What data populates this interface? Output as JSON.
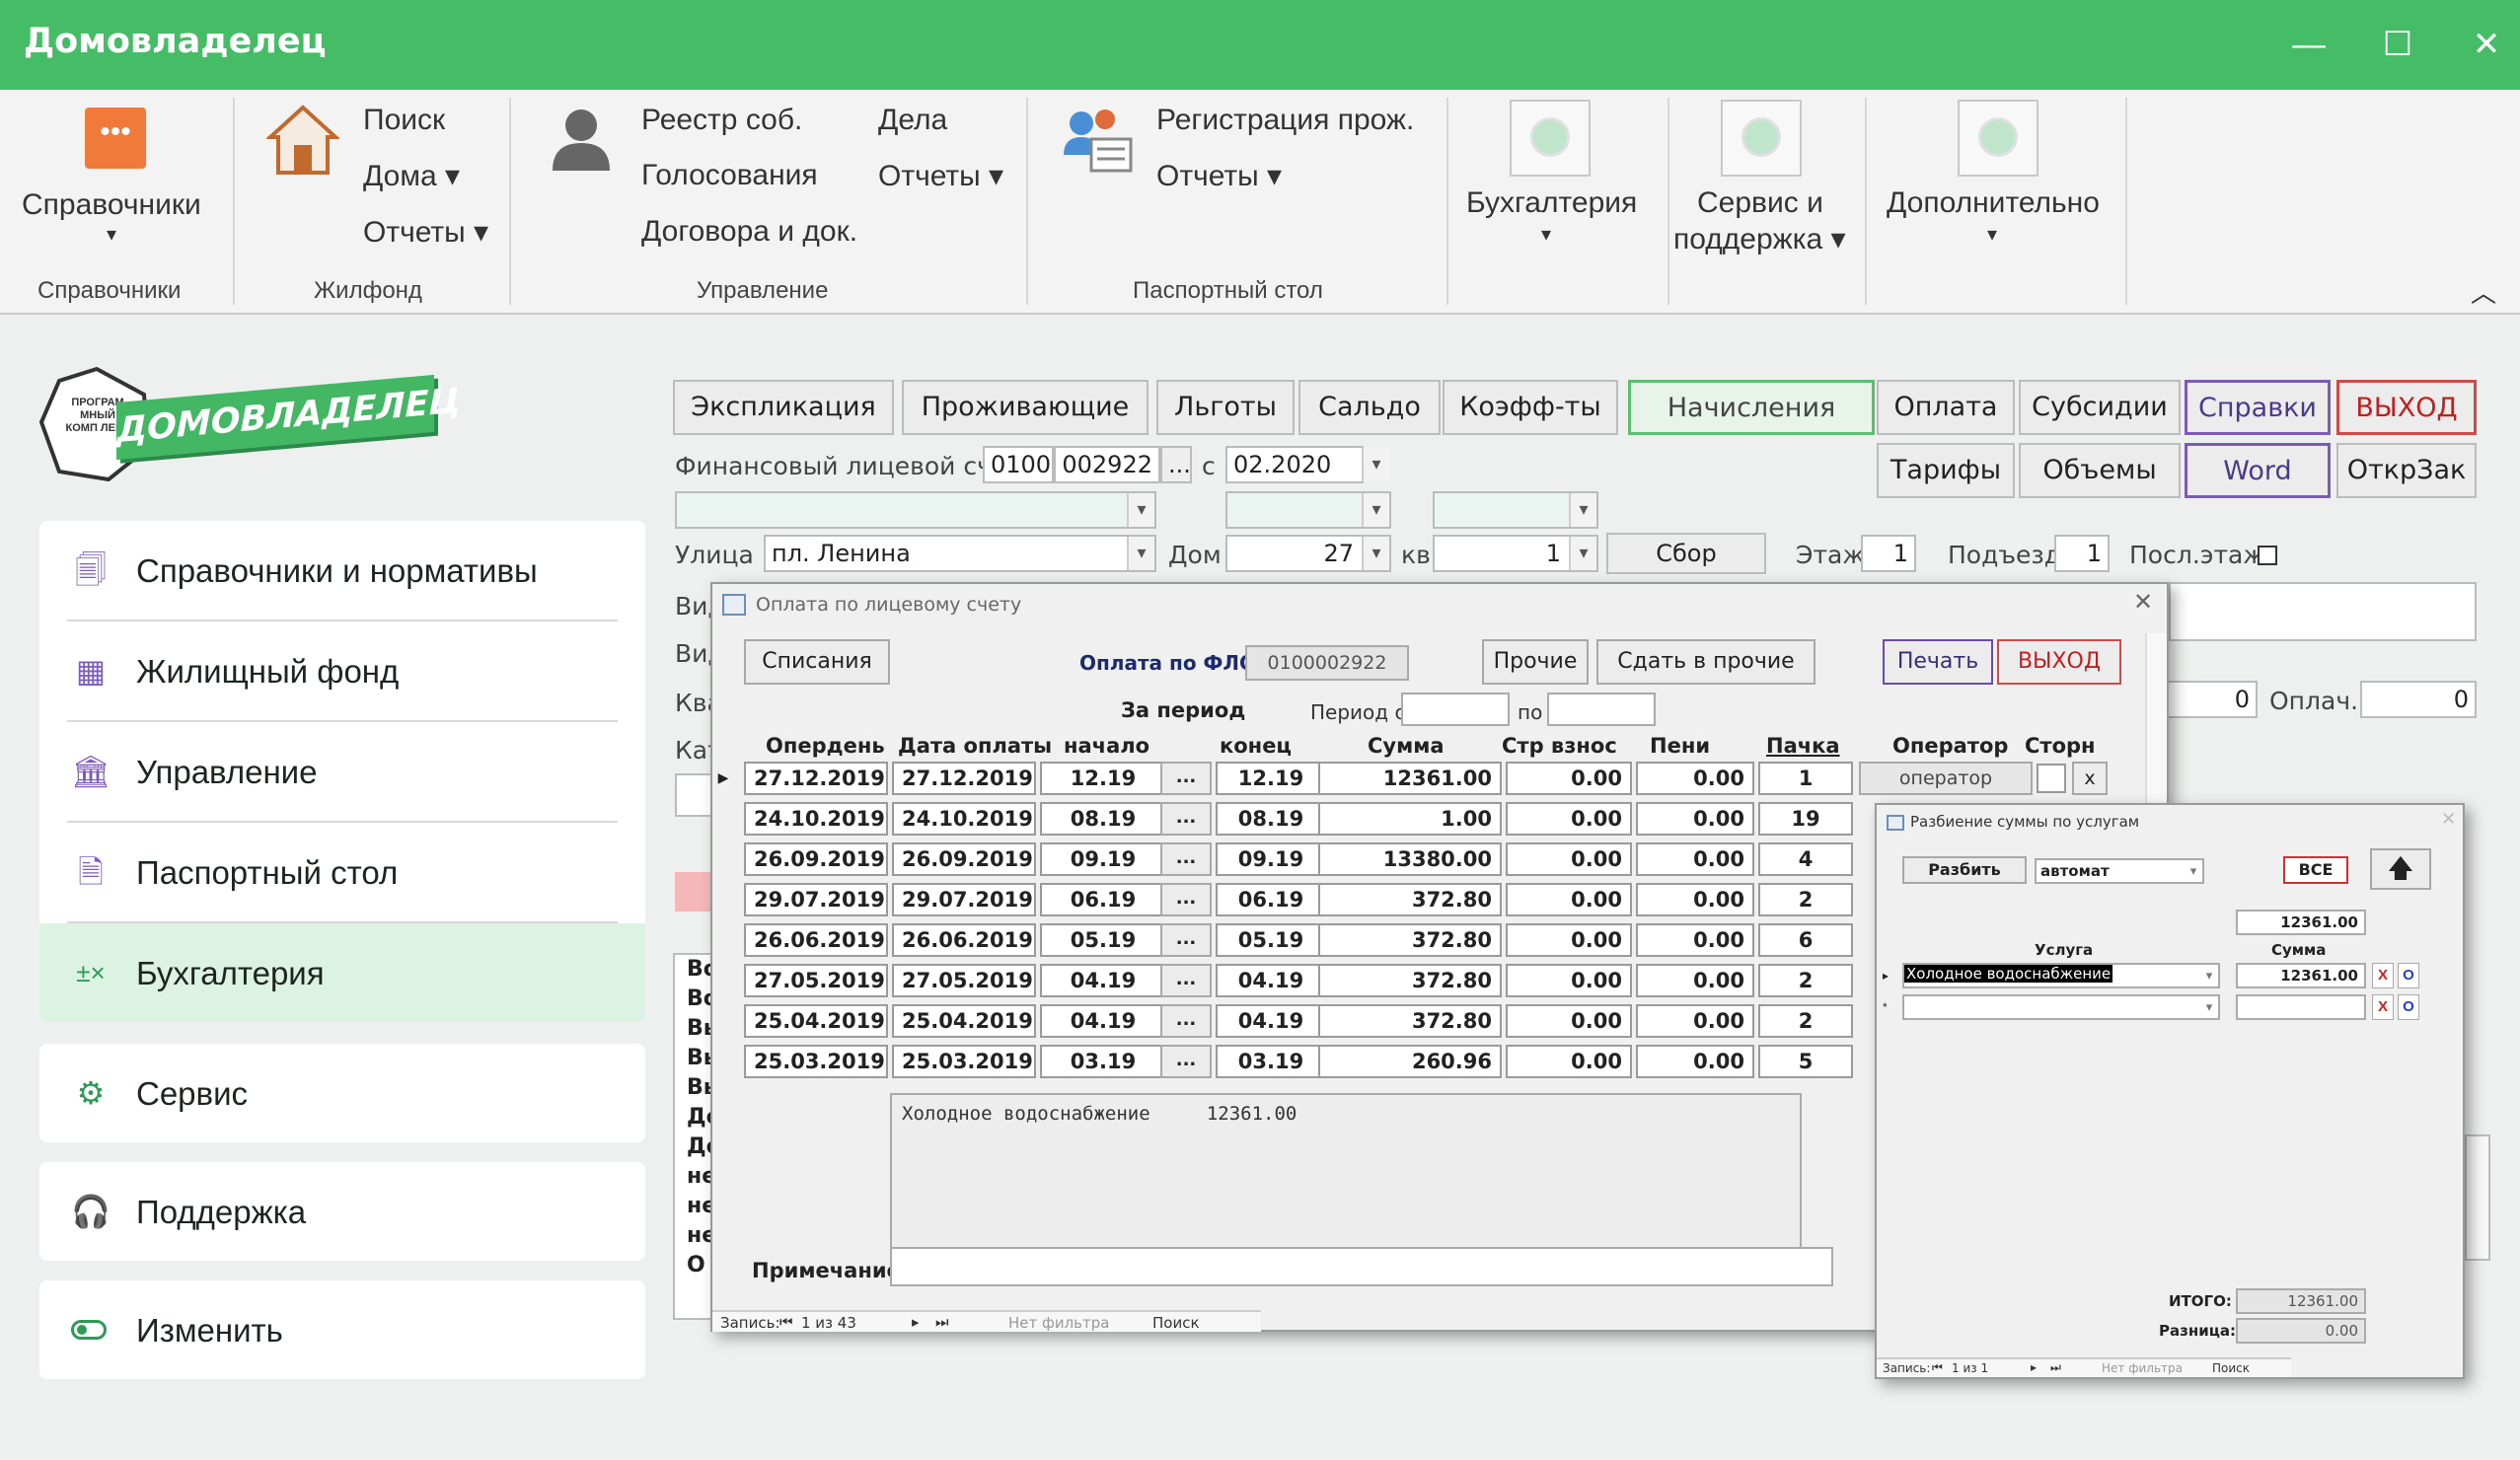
{
  "app": {
    "title": "Домовладелец",
    "min": "—",
    "max": "☐",
    "close": "✕"
  },
  "ribbon": {
    "sprav": {
      "label": "Справочники",
      "group": "Справочники"
    },
    "zhil": {
      "items": [
        "Поиск",
        "Дома ▾",
        "Отчеты ▾"
      ],
      "group": "Жилфонд"
    },
    "upr": {
      "items": [
        "Реестр соб.",
        "Голосования",
        "Договора и док."
      ],
      "items2": [
        "Дела",
        "Отчеты ▾"
      ],
      "group": "Управление"
    },
    "pasp": {
      "items": [
        "Регистрация прож.",
        "Отчеты ▾"
      ],
      "group": "Паспортный стол"
    },
    "buh": {
      "label": "Бухгалтерия"
    },
    "serv": {
      "label1": "Сервис и",
      "label2": "поддержка ▾"
    },
    "dop": {
      "label": "Дополнительно"
    },
    "caret": "▾",
    "collapse": "︿"
  },
  "logo": {
    "text": "ДОМОВЛАДЕЛЕЦ",
    "badge": "ПРОГРАМ МНЫЙ КОМП ЛЕКС"
  },
  "sidebar": {
    "items": [
      "Справочники и нормативы",
      "Жилищный фонд",
      "Управление",
      "Паспортный стол",
      "Бухгалтерия",
      "Сервис",
      "Поддержка",
      "Изменить"
    ],
    "icons": [
      "document-icon",
      "building-icon",
      "bank-icon",
      "passport-icon",
      "calculator-icon",
      "gear-icon",
      "headset-icon",
      "toggle-icon"
    ]
  },
  "main": {
    "tabs": [
      "Экспликация",
      "Проживающие",
      "Льготы",
      "Сальдо",
      "Коэфф-ты",
      "Начисления",
      "Оплата",
      "Субсидии",
      "Справки",
      "ВЫХОД"
    ],
    "tabs2": [
      "Тарифы",
      "Объемы",
      "Word",
      "ОткрЗак"
    ],
    "fls_label": "Финансовый лицевой счет",
    "fls1": "0100",
    "fls2": "002922",
    "dots": "...",
    "s_label": "с",
    "period": "02.2020",
    "ulica_label": "Улица",
    "ulica": "пл. Ленина",
    "dom_label": "Дом",
    "dom": "27",
    "kv_label": "кв",
    "kv": "1",
    "sbor": "Сбор",
    "etazh_label": "Этаж",
    "etazh": "1",
    "podezd_label": "Подъезд",
    "podezd": "1",
    "posl_label": "Посл.этаж",
    "left_labels": [
      "Вид",
      "Вид",
      "Ква",
      "Кат"
    ],
    "left_list": [
      "Во",
      "Во",
      "Вь",
      "Вь",
      "Вь",
      "До",
      "До",
      "не",
      "не",
      "не",
      "О"
    ],
    "val0": "0",
    "oplach": "Оплач.",
    "val0b": "0"
  },
  "dlg1": {
    "title": "Оплата по лицевому счету",
    "close": "✕",
    "spisaniya": "Списания",
    "opl_fls": "Оплата по ФЛС",
    "fls": "0100002922",
    "prochie": "Прочие",
    "sdat": "Сдать в прочие",
    "pechat": "Печать",
    "vyhod": "ВЫХОД",
    "za_period": "За период",
    "period_s": "Период с",
    "po": "по",
    "cols": [
      "Опердень",
      "Дата оплаты",
      "начало",
      "конец",
      "Сумма",
      "Стр взнос",
      "Пени",
      "Пачка",
      "Оператор",
      "Сторн"
    ],
    "rows": [
      [
        "27.12.2019",
        "27.12.2019",
        "12.19",
        "...",
        "12.19",
        "12361.00",
        "0.00",
        "0.00",
        "1"
      ],
      [
        "24.10.2019",
        "24.10.2019",
        "08.19",
        "...",
        "08.19",
        "1.00",
        "0.00",
        "0.00",
        "19"
      ],
      [
        "26.09.2019",
        "26.09.2019",
        "09.19",
        "...",
        "09.19",
        "13380.00",
        "0.00",
        "0.00",
        "4"
      ],
      [
        "29.07.2019",
        "29.07.2019",
        "06.19",
        "...",
        "06.19",
        "372.80",
        "0.00",
        "0.00",
        "2"
      ],
      [
        "26.06.2019",
        "26.06.2019",
        "05.19",
        "...",
        "05.19",
        "372.80",
        "0.00",
        "0.00",
        "6"
      ],
      [
        "27.05.2019",
        "27.05.2019",
        "04.19",
        "...",
        "04.19",
        "372.80",
        "0.00",
        "0.00",
        "2"
      ],
      [
        "25.04.2019",
        "25.04.2019",
        "04.19",
        "...",
        "04.19",
        "372.80",
        "0.00",
        "0.00",
        "2"
      ],
      [
        "25.03.2019",
        "25.03.2019",
        "03.19",
        "...",
        "03.19",
        "260.96",
        "0.00",
        "0.00",
        "5"
      ]
    ],
    "operator": "оператор",
    "x": "x",
    "memo": "Холодное водоснабжение     12361.00",
    "prim": "Примечание",
    "nav": {
      "zapis": "Запись:",
      "pos": "1 из 43",
      "filter": "Нет фильтра",
      "search": "Поиск"
    }
  },
  "dlg2": {
    "title": "Разбиение суммы по услугам",
    "close": "✕",
    "razbit": "Разбить",
    "mode": "автомат",
    "vse": "ВСЕ",
    "up": "🡅",
    "total_top": "12361.00",
    "col_usluga": "Услуга",
    "col_summa": "Сумма",
    "row_usluga": "Холодное водоснабжение",
    "row_summa": "12361.00",
    "x": "X",
    "o": "O",
    "itogo_lbl": "ИТОГО:",
    "itogo": "12361.00",
    "raznica_lbl": "Разница:",
    "raznica": "0.00",
    "nav": {
      "zapis": "Запись:",
      "pos": "1 из 1",
      "filter": "Нет фильтра",
      "search": "Поиск"
    }
  }
}
